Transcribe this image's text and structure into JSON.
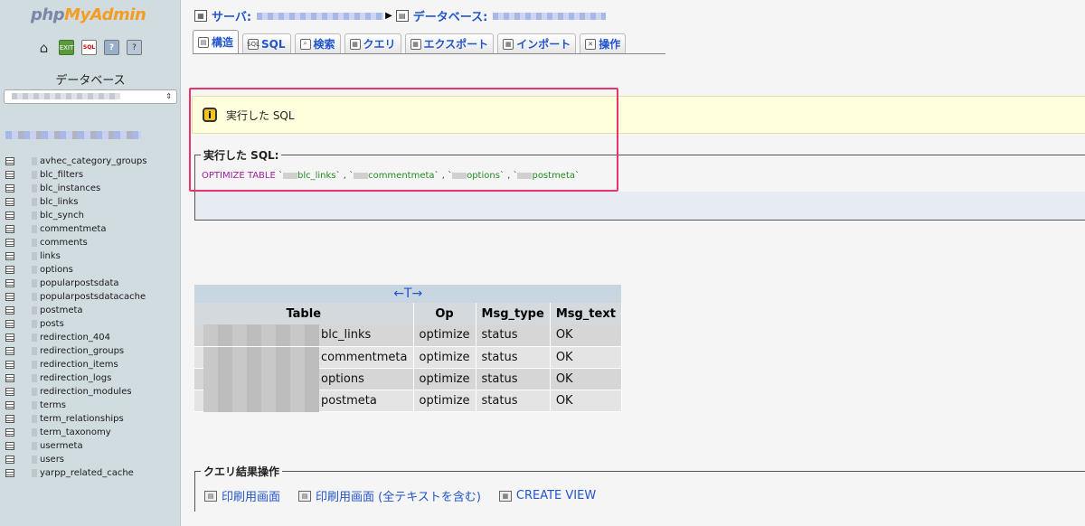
{
  "sidebar": {
    "logo": {
      "php": "php",
      "my": "My",
      "admin": "Admin"
    },
    "db_label": "データベース",
    "tables": [
      "avhec_category_groups",
      "blc_filters",
      "blc_instances",
      "blc_links",
      "blc_synch",
      "commentmeta",
      "comments",
      "links",
      "options",
      "popularpostsdata",
      "popularpostsdatacache",
      "postmeta",
      "posts",
      "redirection_404",
      "redirection_groups",
      "redirection_items",
      "redirection_logs",
      "redirection_modules",
      "terms",
      "term_relationships",
      "term_taxonomy",
      "usermeta",
      "users",
      "yarpp_related_cache"
    ]
  },
  "breadcrumb": {
    "server_label": "サーバ:",
    "database_label": "データベース:"
  },
  "tabs": [
    {
      "label": "構造",
      "icon": "structure-icon"
    },
    {
      "label": "SQL",
      "icon": "sql-icon"
    },
    {
      "label": "検索",
      "icon": "search-icon"
    },
    {
      "label": "クエリ",
      "icon": "query-icon"
    },
    {
      "label": "エクスポート",
      "icon": "export-icon"
    },
    {
      "label": "インポート",
      "icon": "import-icon"
    },
    {
      "label": "操作",
      "icon": "tools-icon"
    }
  ],
  "notice": {
    "text": "実行した SQL"
  },
  "sql_box": {
    "legend": "実行した SQL:",
    "keyword": "OPTIMIZE TABLE",
    "tables": [
      "blc_links",
      "commentmeta",
      "options",
      "postmeta"
    ]
  },
  "result": {
    "nav_arrows": "←T→",
    "headers": [
      "Table",
      "Op",
      "Msg_type",
      "Msg_text"
    ],
    "rows": [
      {
        "table": "blc_links",
        "op": "optimize",
        "msg_type": "status",
        "msg_text": "OK"
      },
      {
        "table": "commentmeta",
        "op": "optimize",
        "msg_type": "status",
        "msg_text": "OK"
      },
      {
        "table": "options",
        "op": "optimize",
        "msg_type": "status",
        "msg_text": "OK"
      },
      {
        "table": "postmeta",
        "op": "optimize",
        "msg_type": "status",
        "msg_text": "OK"
      }
    ]
  },
  "ops": {
    "legend": "クエリ結果操作",
    "print_view": "印刷用画面",
    "print_view_full": "印刷用画面 (全テキストを含む)",
    "create_view": "CREATE VIEW"
  },
  "colors": {
    "accent": "#2255cc",
    "highlight": "#e8336d",
    "notice_bg": "#ffffdd"
  }
}
